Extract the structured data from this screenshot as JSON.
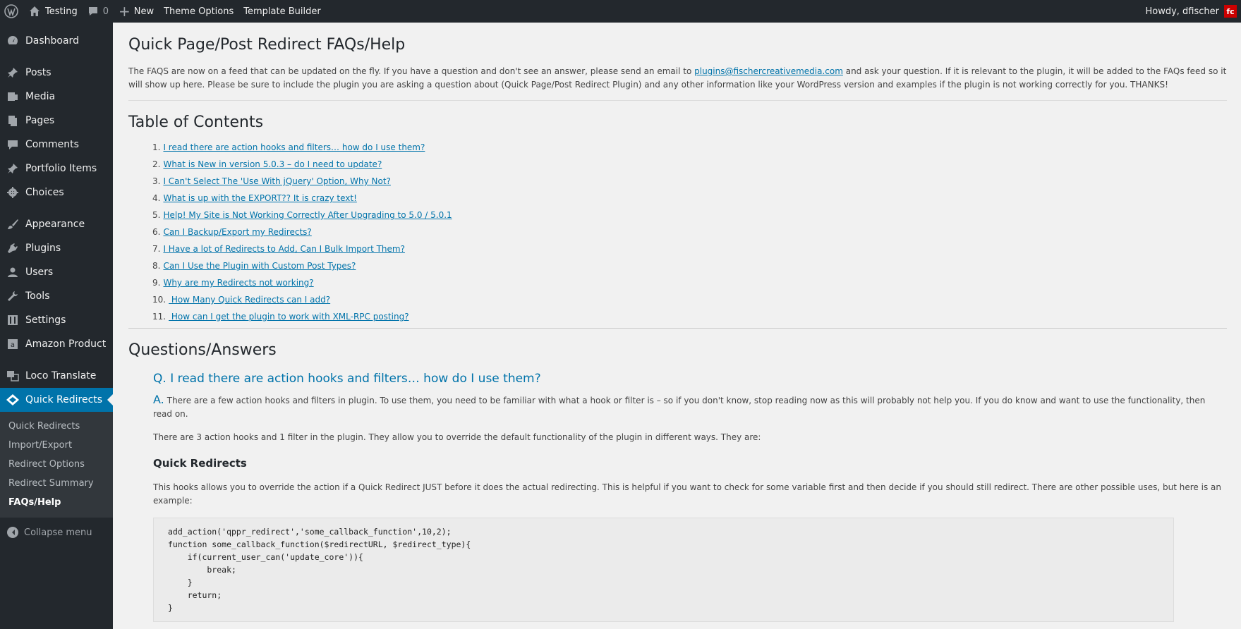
{
  "adminbar": {
    "site_name": "Testing",
    "comments_count": "0",
    "new_label": "New",
    "theme_options": "Theme Options",
    "template_builder": "Template Builder",
    "howdy": "Howdy, dfischer",
    "avatar_text": "fc"
  },
  "sidebar": {
    "items": [
      {
        "label": "Dashboard",
        "icon": "dashboard-icon"
      },
      {
        "label": "Posts",
        "icon": "pin-icon"
      },
      {
        "label": "Media",
        "icon": "media-icon"
      },
      {
        "label": "Pages",
        "icon": "pages-icon"
      },
      {
        "label": "Comments",
        "icon": "comment-icon"
      },
      {
        "label": "Portfolio Items",
        "icon": "pin-icon"
      },
      {
        "label": "Choices",
        "icon": "gear-icon"
      },
      {
        "label": "Appearance",
        "icon": "brush-icon"
      },
      {
        "label": "Plugins",
        "icon": "plug-icon"
      },
      {
        "label": "Users",
        "icon": "user-icon"
      },
      {
        "label": "Tools",
        "icon": "wrench-icon"
      },
      {
        "label": "Settings",
        "icon": "settings-icon"
      },
      {
        "label": "Amazon Product",
        "icon": "amazon-icon"
      },
      {
        "label": "Loco Translate",
        "icon": "translate-icon"
      },
      {
        "label": "Quick Redirects",
        "icon": "redirect-icon"
      }
    ],
    "submenu": [
      "Quick Redirects",
      "Import/Export",
      "Redirect Options",
      "Redirect Summary",
      "FAQs/Help"
    ],
    "collapse": "Collapse menu"
  },
  "content": {
    "title": "Quick Page/Post Redirect FAQs/Help",
    "intro_before": "The FAQS are now on a feed that can be updated on the fly. If you have a question and don't see an answer, please send an email to ",
    "intro_email": "plugins@fischercreativemedia.com",
    "intro_after": " and ask your question. If it is relevant to the plugin, it will be added to the FAQs feed so it will show up here. Please be sure to include the plugin you are asking a question about (Quick Page/Post Redirect Plugin) and any other information like your WordPress version and examples if the plugin is not working correctly for you. THANKS!",
    "toc_title": "Table of Contents",
    "toc": [
      {
        "num": "1.",
        "text": "I read there are action hooks and filters… how do I use them?"
      },
      {
        "num": "2.",
        "text": "What is New in version 5.0.3 – do I need to update?"
      },
      {
        "num": "3.",
        "text": "I Can't Select The 'Use With jQuery' Option, Why Not?"
      },
      {
        "num": "4.",
        "text": "What is up with the EXPORT?? It is crazy text!"
      },
      {
        "num": "5.",
        "text": "Help! My Site is Not Working Correctly After Upgrading to 5.0 / 5.0.1"
      },
      {
        "num": "6.",
        "text": "Can I Backup/Export my Redirects?"
      },
      {
        "num": "7.",
        "text": "I Have a lot of Redirects to Add, Can I Bulk Import Them?"
      },
      {
        "num": "8.",
        "text": "Can I Use the Plugin with Custom Post Types?"
      },
      {
        "num": "9.",
        "text": "Why are my Redirects not working?"
      },
      {
        "num": "10.",
        "text": " How Many Quick Redirects can I add?"
      },
      {
        "num": "11.",
        "text": " How can I get the plugin to work with XML-RPC posting?"
      }
    ],
    "qa_title": "Questions/Answers",
    "question": "Q. I read there are action hooks and filters… how do I use them?",
    "answer_letter": "A.",
    "answer": "There are a few action hooks and filters in plugin. To use them, you need to be familiar with what a hook or filter is – so if you don't know, stop reading now as this will probably not help you. If you do know and want to use the functionality, then read on.",
    "para1": "There are 3 action hooks and 1 filter in the plugin. They allow you to override the default functionality of the plugin in different ways. They are:",
    "sub_heading": "Quick Redirects",
    "para2": "This hooks allows you to override the action if a Quick Redirect JUST before it does the actual redirecting. This is helpful if you want to check for some variable first and then decide if you should still redirect. There are other possible uses, but here is an example:",
    "code": "add_action('qppr_redirect','some_callback_function',10,2);\nfunction some_callback_function($redirectURL, $redirect_type){\n    if(current_user_can('update_core')){\n        break;\n    }\n    return;\n}"
  }
}
